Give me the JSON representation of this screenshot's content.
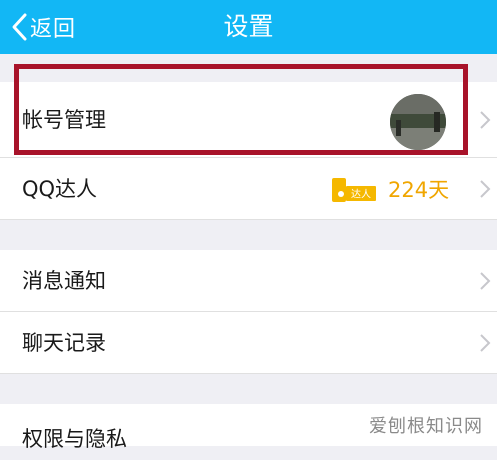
{
  "header": {
    "back_label": "返回",
    "title": "设置"
  },
  "rows": {
    "account": {
      "label": "帐号管理"
    },
    "qq_daren": {
      "label": "QQ达人",
      "badge_text": "达人",
      "days": "224天"
    },
    "notifications": {
      "label": "消息通知"
    },
    "chat_history": {
      "label": "聊天记录"
    },
    "privacy": {
      "label": "权限与隐私"
    }
  },
  "watermark": "爱刨根知识网",
  "colors": {
    "header_bg": "#12b7f5",
    "highlight_border": "#a8132a",
    "badge": "#f5b800",
    "page_bg": "#efeff4"
  },
  "icons": [
    "back-chevron-icon",
    "chevron-right-icon",
    "daren-badge-icon"
  ]
}
